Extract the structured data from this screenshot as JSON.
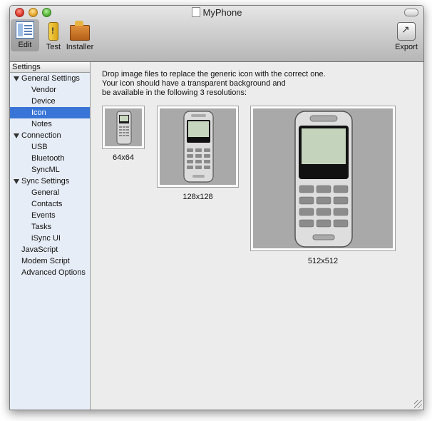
{
  "window": {
    "title": "MyPhone"
  },
  "toolbar": {
    "items": [
      {
        "label": "Edit",
        "icon": "edit-icon"
      },
      {
        "label": "Test",
        "icon": "test-icon"
      },
      {
        "label": "Installer",
        "icon": "installer-icon"
      },
      {
        "label": "Export",
        "icon": "export-icon"
      }
    ]
  },
  "sidebar": {
    "header": "Settings",
    "items": [
      {
        "label": "General Settings",
        "level": 0,
        "disclosure": true
      },
      {
        "label": "Vendor",
        "level": 1
      },
      {
        "label": "Device",
        "level": 1
      },
      {
        "label": "Icon",
        "level": 1,
        "selected": true
      },
      {
        "label": "Notes",
        "level": 1
      },
      {
        "label": "Connection",
        "level": 0,
        "disclosure": true
      },
      {
        "label": "USB",
        "level": 1
      },
      {
        "label": "Bluetooth",
        "level": 1
      },
      {
        "label": "SyncML",
        "level": 1
      },
      {
        "label": "Sync Settings",
        "level": 0,
        "disclosure": true
      },
      {
        "label": "General",
        "level": 1
      },
      {
        "label": "Contacts",
        "level": 1
      },
      {
        "label": "Events",
        "level": 1
      },
      {
        "label": "Tasks",
        "level": 1
      },
      {
        "label": "iSync UI",
        "level": 1
      },
      {
        "label": "JavaScript",
        "level": 0
      },
      {
        "label": "Modem Script",
        "level": 0
      },
      {
        "label": "Advanced Options",
        "level": 0
      }
    ]
  },
  "main": {
    "instructions": [
      "Drop image files to replace the generic icon with the correct one.",
      "Your icon should have a transparent background and",
      "be available in the following 3 resolutions:"
    ],
    "wells": [
      {
        "label": "64x64"
      },
      {
        "label": "128x128"
      },
      {
        "label": "512x512"
      }
    ]
  },
  "colors": {
    "selection": "#3875d7",
    "sidebar_bg": "#e7edf6",
    "well_bg": "#a9a9a9"
  }
}
